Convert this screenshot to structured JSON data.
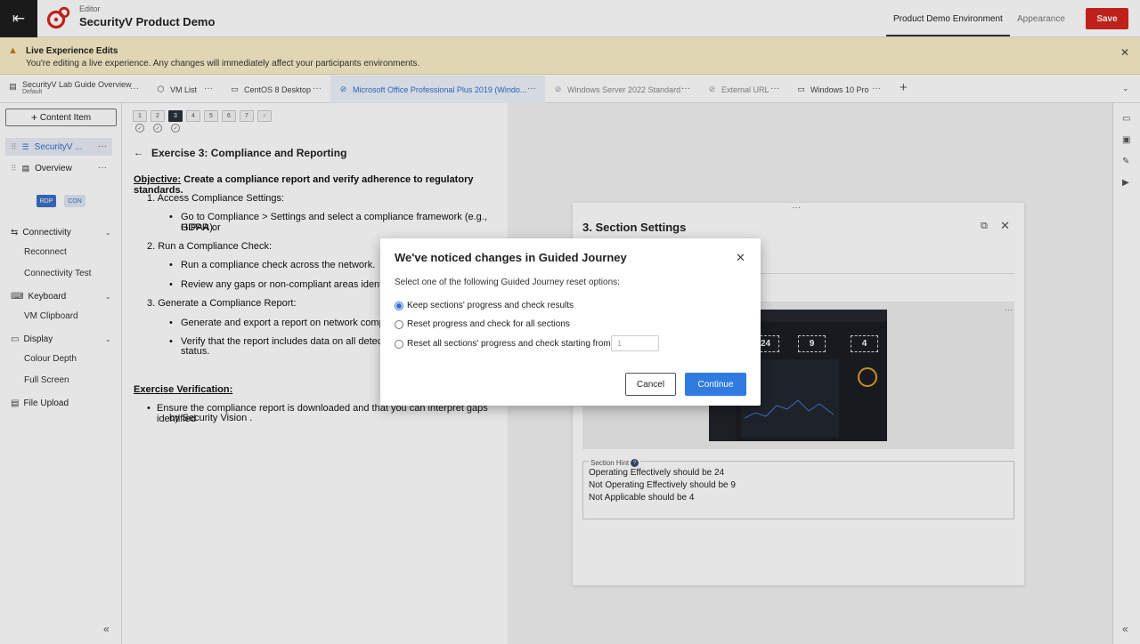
{
  "header": {
    "editor_label": "Editor",
    "app_title": "SecurityV Product Demo",
    "tabs": [
      {
        "label": "Product Demo Environment"
      },
      {
        "label": "Appearance"
      }
    ],
    "save_label": "Save",
    "brand_color": "#d4251c"
  },
  "banner": {
    "title": "Live Experience Edits",
    "text": "You're editing a live experience. Any changes will immediately affect your participants environments."
  },
  "tabs": [
    {
      "label": "SecurityV Lab Guide Overview",
      "sub": "Default"
    },
    {
      "label": "VM List"
    },
    {
      "label": "CentOS 8 Desktop"
    },
    {
      "label": "Microsoft Office Professional Plus 2019 (Windo..."
    },
    {
      "label": "Windows Server 2022 Standard"
    },
    {
      "label": "External URL"
    },
    {
      "label": "Windows 10 Pro"
    }
  ],
  "sidebar": {
    "add_label": "Content Item",
    "items": [
      {
        "label": "SecurityV ..."
      },
      {
        "label": "Overview"
      }
    ],
    "pills": [
      "RDP",
      "CON"
    ],
    "sections": [
      {
        "label": "Connectivity",
        "items": [
          "Reconnect",
          "Connectivity Test"
        ]
      },
      {
        "label": "Keyboard",
        "items": [
          "VM Clipboard"
        ]
      },
      {
        "label": "Display",
        "items": [
          "Colour Depth",
          "Full Screen"
        ]
      }
    ],
    "file_upload": "File Upload",
    "collapse_glyph": "«"
  },
  "content": {
    "steps": [
      "1",
      "2",
      "3",
      "4",
      "5",
      "6",
      "7",
      "+"
    ],
    "exercise_title": "Exercise 3: Compliance and Reporting",
    "objective_label": "Objective:",
    "objective_text": " Create a compliance report and verify adherence to regulatory standards.",
    "items": [
      "1. Access Compliance Settings:",
      "Go to Compliance > Settings and select a compliance framework (e.g., GDPR or",
      "HIPAA).",
      "2. Run a Compliance Check:",
      "Run a compliance check across the network.",
      "Review any gaps or non-compliant areas identified",
      "3. Generate a Compliance Report:",
      "Generate and export a report on network complian",
      "Verify that the report includes data on all detected t",
      "status."
    ],
    "verification_label": "Exercise Verification:",
    "verification_lines": [
      "Ensure the compliance report is downloaded and that you can interpret gaps identified",
      "by Security Vision ."
    ]
  },
  "panel": {
    "title": "3. Section Settings",
    "dash_values": [
      "24",
      "9",
      "4"
    ],
    "hint_label": "Section Hint",
    "hint_lines": [
      "Operating Effectively should be 24",
      "Not Operating Effectively should be 9",
      "Not Applicable should be 4"
    ]
  },
  "modal": {
    "title": "We've noticed changes in Guided Journey",
    "subtitle": "Select one of the following Guided Journey reset options:",
    "options": [
      {
        "label": "Keep sections' progress and check results",
        "selected": true
      },
      {
        "label": "Reset progress and check for all sections",
        "selected": false
      },
      {
        "label": "Reset all sections' progress and check starting from:",
        "selected": false
      }
    ],
    "start_value": "1",
    "cancel_label": "Cancel",
    "continue_label": "Continue"
  }
}
